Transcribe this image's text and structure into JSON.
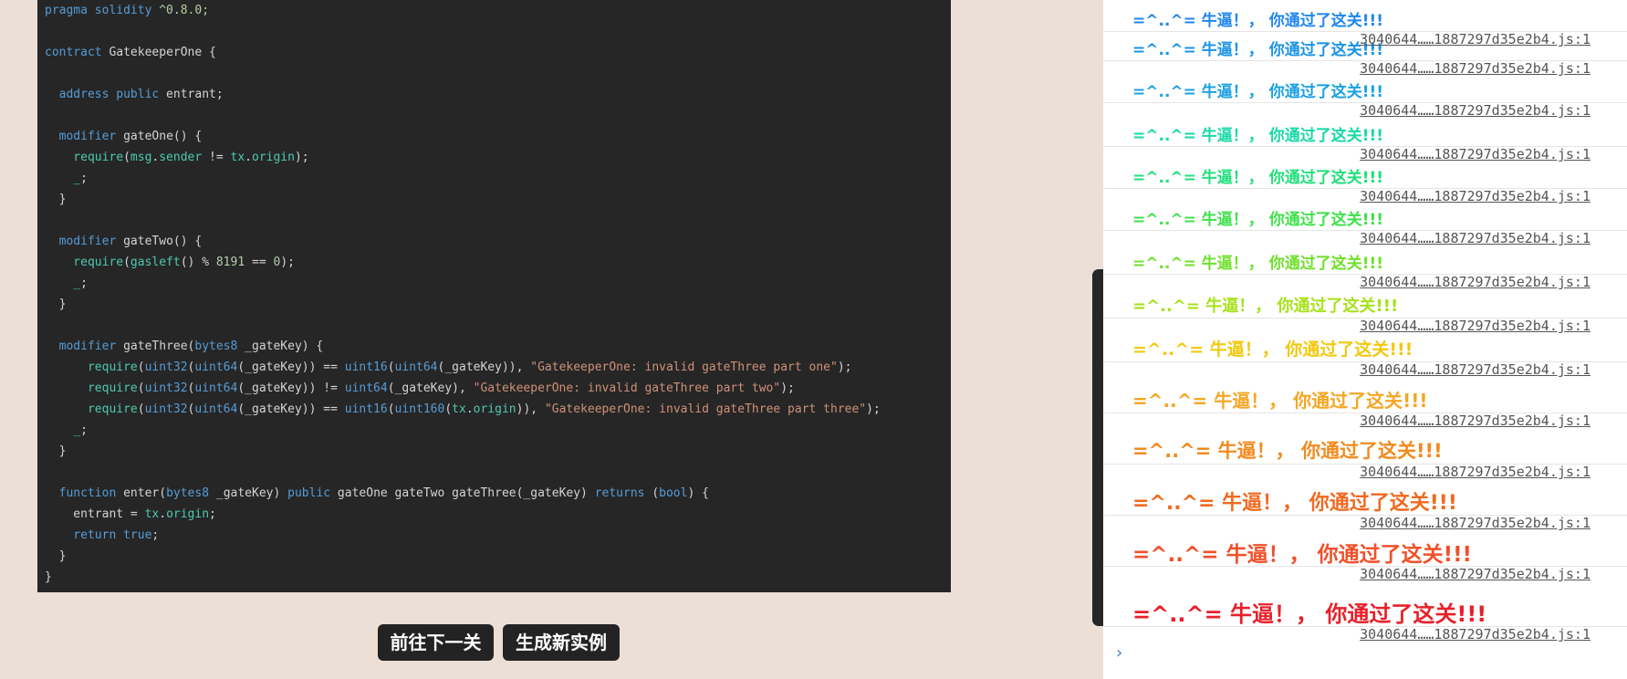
{
  "code": {
    "lines": [
      [
        {
          "t": "pragma solidity",
          "c": "#569cd6"
        },
        {
          "t": " ^0.8.0;",
          "c": "#b5cea8"
        }
      ],
      [],
      [
        {
          "t": "contract",
          "c": "#569cd6"
        },
        {
          "t": " GatekeeperOne {",
          "c": "#d4d4d4"
        }
      ],
      [],
      [
        {
          "t": "  address public",
          "c": "#569cd6"
        },
        {
          "t": " entrant;",
          "c": "#d4d4d4"
        }
      ],
      [],
      [
        {
          "t": "  modifier",
          "c": "#569cd6"
        },
        {
          "t": " gateOne() {",
          "c": "#d4d4d4"
        }
      ],
      [
        {
          "t": "    require",
          "c": "#4ec9b0"
        },
        {
          "t": "(",
          "c": "#d4d4d4"
        },
        {
          "t": "msg",
          "c": "#4ec9b0"
        },
        {
          "t": ".",
          "c": "#d4d4d4"
        },
        {
          "t": "sender",
          "c": "#4ec9b0"
        },
        {
          "t": " != ",
          "c": "#d4d4d4"
        },
        {
          "t": "tx",
          "c": "#4ec9b0"
        },
        {
          "t": ".",
          "c": "#d4d4d4"
        },
        {
          "t": "origin",
          "c": "#4ec9b0"
        },
        {
          "t": ");",
          "c": "#d4d4d4"
        }
      ],
      [
        {
          "t": "    _",
          "c": "#4ec9b0"
        },
        {
          "t": ";",
          "c": "#d4d4d4"
        }
      ],
      [
        {
          "t": "  }",
          "c": "#d4d4d4"
        }
      ],
      [],
      [
        {
          "t": "  modifier",
          "c": "#569cd6"
        },
        {
          "t": " gateTwo() {",
          "c": "#d4d4d4"
        }
      ],
      [
        {
          "t": "    require",
          "c": "#4ec9b0"
        },
        {
          "t": "(",
          "c": "#d4d4d4"
        },
        {
          "t": "gasleft",
          "c": "#4ec9b0"
        },
        {
          "t": "() % ",
          "c": "#d4d4d4"
        },
        {
          "t": "8191",
          "c": "#b5cea8"
        },
        {
          "t": " == ",
          "c": "#d4d4d4"
        },
        {
          "t": "0",
          "c": "#b5cea8"
        },
        {
          "t": ");",
          "c": "#d4d4d4"
        }
      ],
      [
        {
          "t": "    _",
          "c": "#4ec9b0"
        },
        {
          "t": ";",
          "c": "#d4d4d4"
        }
      ],
      [
        {
          "t": "  }",
          "c": "#d4d4d4"
        }
      ],
      [],
      [
        {
          "t": "  modifier",
          "c": "#569cd6"
        },
        {
          "t": " gateThree(",
          "c": "#d4d4d4"
        },
        {
          "t": "bytes8",
          "c": "#569cd6"
        },
        {
          "t": " _gateKey) {",
          "c": "#d4d4d4"
        }
      ],
      [
        {
          "t": "      require",
          "c": "#4ec9b0"
        },
        {
          "t": "(",
          "c": "#d4d4d4"
        },
        {
          "t": "uint32",
          "c": "#569cd6"
        },
        {
          "t": "(",
          "c": "#d4d4d4"
        },
        {
          "t": "uint64",
          "c": "#569cd6"
        },
        {
          "t": "(_gateKey)) == ",
          "c": "#d4d4d4"
        },
        {
          "t": "uint16",
          "c": "#569cd6"
        },
        {
          "t": "(",
          "c": "#d4d4d4"
        },
        {
          "t": "uint64",
          "c": "#569cd6"
        },
        {
          "t": "(_gateKey)), ",
          "c": "#d4d4d4"
        },
        {
          "t": "\"GatekeeperOne: invalid gateThree part one\"",
          "c": "#ce9178"
        },
        {
          "t": ");",
          "c": "#d4d4d4"
        }
      ],
      [
        {
          "t": "      require",
          "c": "#4ec9b0"
        },
        {
          "t": "(",
          "c": "#d4d4d4"
        },
        {
          "t": "uint32",
          "c": "#569cd6"
        },
        {
          "t": "(",
          "c": "#d4d4d4"
        },
        {
          "t": "uint64",
          "c": "#569cd6"
        },
        {
          "t": "(_gateKey)) != ",
          "c": "#d4d4d4"
        },
        {
          "t": "uint64",
          "c": "#569cd6"
        },
        {
          "t": "(_gateKey), ",
          "c": "#d4d4d4"
        },
        {
          "t": "\"GatekeeperOne: invalid gateThree part two\"",
          "c": "#ce9178"
        },
        {
          "t": ");",
          "c": "#d4d4d4"
        }
      ],
      [
        {
          "t": "      require",
          "c": "#4ec9b0"
        },
        {
          "t": "(",
          "c": "#d4d4d4"
        },
        {
          "t": "uint32",
          "c": "#569cd6"
        },
        {
          "t": "(",
          "c": "#d4d4d4"
        },
        {
          "t": "uint64",
          "c": "#569cd6"
        },
        {
          "t": "(_gateKey)) == ",
          "c": "#d4d4d4"
        },
        {
          "t": "uint16",
          "c": "#569cd6"
        },
        {
          "t": "(",
          "c": "#d4d4d4"
        },
        {
          "t": "uint160",
          "c": "#569cd6"
        },
        {
          "t": "(",
          "c": "#d4d4d4"
        },
        {
          "t": "tx",
          "c": "#4ec9b0"
        },
        {
          "t": ".",
          "c": "#d4d4d4"
        },
        {
          "t": "origin",
          "c": "#4ec9b0"
        },
        {
          "t": ")), ",
          "c": "#d4d4d4"
        },
        {
          "t": "\"GatekeeperOne: invalid gateThree part three\"",
          "c": "#ce9178"
        },
        {
          "t": ");",
          "c": "#d4d4d4"
        }
      ],
      [
        {
          "t": "    _",
          "c": "#4ec9b0"
        },
        {
          "t": ";",
          "c": "#d4d4d4"
        }
      ],
      [
        {
          "t": "  }",
          "c": "#d4d4d4"
        }
      ],
      [],
      [
        {
          "t": "  function",
          "c": "#569cd6"
        },
        {
          "t": " enter(",
          "c": "#d4d4d4"
        },
        {
          "t": "bytes8",
          "c": "#569cd6"
        },
        {
          "t": " _gateKey) ",
          "c": "#d4d4d4"
        },
        {
          "t": "public",
          "c": "#569cd6"
        },
        {
          "t": " gateOne gateTwo gateThree(_gateKey) ",
          "c": "#d4d4d4"
        },
        {
          "t": "returns",
          "c": "#569cd6"
        },
        {
          "t": " (",
          "c": "#d4d4d4"
        },
        {
          "t": "bool",
          "c": "#569cd6"
        },
        {
          "t": ") {",
          "c": "#d4d4d4"
        }
      ],
      [
        {
          "t": "    entrant = ",
          "c": "#d4d4d4"
        },
        {
          "t": "tx",
          "c": "#4ec9b0"
        },
        {
          "t": ".",
          "c": "#d4d4d4"
        },
        {
          "t": "origin",
          "c": "#4ec9b0"
        },
        {
          "t": ";",
          "c": "#d4d4d4"
        }
      ],
      [
        {
          "t": "    return true",
          "c": "#569cd6"
        },
        {
          "t": ";",
          "c": "#d4d4d4"
        }
      ],
      [
        {
          "t": "  }",
          "c": "#d4d4d4"
        }
      ],
      [
        {
          "t": "}",
          "c": "#d4d4d4"
        }
      ]
    ]
  },
  "buttons": {
    "next_level": "前往下一关",
    "new_instance": "生成新实例"
  },
  "console": {
    "prompt_symbol": "›",
    "entries": [
      {
        "message": "=^..^= 牛逼！， 你通过了这关!!!",
        "source": "3040644……1887297d35e2b4.js:1",
        "color": "#1f86f0",
        "size": 17
      },
      {
        "message": "=^..^= 牛逼！， 你通过了这关!!!",
        "source": "3040644……1887297d35e2b4.js:1",
        "color": "#1b93e6",
        "size": 17
      },
      {
        "message": "=^..^= 牛逼！， 你通过了这关!!!",
        "source": "3040644……1887297d35e2b4.js:1",
        "color": "#1aa0e0",
        "size": 17
      },
      {
        "message": "=^..^= 牛逼！， 你通过了这关!!!",
        "source": "3040644……1887297d35e2b4.js:1",
        "color": "#17d9a6",
        "size": 17
      },
      {
        "message": "=^..^= 牛逼！， 你通过了这关!!!",
        "source": "3040644……1887297d35e2b4.js:1",
        "color": "#1fe07a",
        "size": 17
      },
      {
        "message": "=^..^= 牛逼！， 你通过了这关!!!",
        "source": "3040644……1887297d35e2b4.js:1",
        "color": "#3fe04a",
        "size": 17
      },
      {
        "message": "=^..^= 牛逼！， 你通过了这关!!!",
        "source": "3040644……1887297d35e2b4.js:1",
        "color": "#6fe02a",
        "size": 17
      },
      {
        "message": "=^..^= 牛逼！， 你通过了这关!!!",
        "source": "3040644……1887297d35e2b4.js:1",
        "color": "#a6e21a",
        "size": 18
      },
      {
        "message": "=^..^= 牛逼！， 你通过了这关!!!",
        "source": "3040644……1887297d35e2b4.js:1",
        "color": "#f2c80f",
        "size": 19
      },
      {
        "message": "=^..^= 牛逼！， 你通过了这关!!!",
        "source": "3040644……1887297d35e2b4.js:1",
        "color": "#f5a623",
        "size": 20
      },
      {
        "message": "=^..^= 牛逼！， 你通过了这关!!!",
        "source": "3040644……1887297d35e2b4.js:1",
        "color": "#f28a1e",
        "size": 21
      },
      {
        "message": "=^..^= 牛逼！， 你通过了这关!!!",
        "source": "3040644……1887297d35e2b4.js:1",
        "color": "#f06a20",
        "size": 22
      },
      {
        "message": "=^..^= 牛逼！， 你通过了这关!!!",
        "source": "3040644……1887297d35e2b4.js:1",
        "color": "#f0502a",
        "size": 23
      },
      {
        "message": "=^..^= 牛逼！， 你通过了这关!!!",
        "source": "3040644……1887297d35e2b4.js:1",
        "color": "#e8202a",
        "size": 24
      }
    ]
  }
}
